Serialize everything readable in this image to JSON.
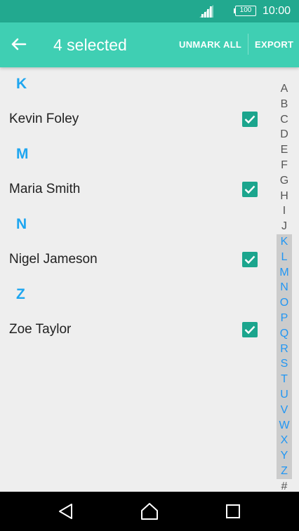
{
  "status": {
    "battery": "100",
    "time": "10:00"
  },
  "app_bar": {
    "title": "4 selected",
    "unmark_label": "UNMARK ALL",
    "export_label": "EXPORT"
  },
  "sections": [
    {
      "letter": "K",
      "contacts": [
        {
          "name": "Kevin Foley",
          "checked": true
        }
      ]
    },
    {
      "letter": "M",
      "contacts": [
        {
          "name": "Maria Smith",
          "checked": true
        }
      ]
    },
    {
      "letter": "N",
      "contacts": [
        {
          "name": "Nigel Jameson",
          "checked": true
        }
      ]
    },
    {
      "letter": "Z",
      "contacts": [
        {
          "name": "Zoe Taylor",
          "checked": true
        }
      ]
    }
  ],
  "index": {
    "letters": [
      "A",
      "B",
      "C",
      "D",
      "E",
      "F",
      "G",
      "H",
      "I",
      "J",
      "K",
      "L",
      "M",
      "N",
      "O",
      "P",
      "Q",
      "R",
      "S",
      "T",
      "U",
      "V",
      "W",
      "X",
      "Y",
      "Z",
      "#"
    ],
    "active_from": "K",
    "active_to": "Z"
  },
  "colors": {
    "status_bar": "#22a98f",
    "app_bar": "#3fcfb3",
    "accent": "#1ea6f0",
    "checkbox": "#1ba58d"
  }
}
